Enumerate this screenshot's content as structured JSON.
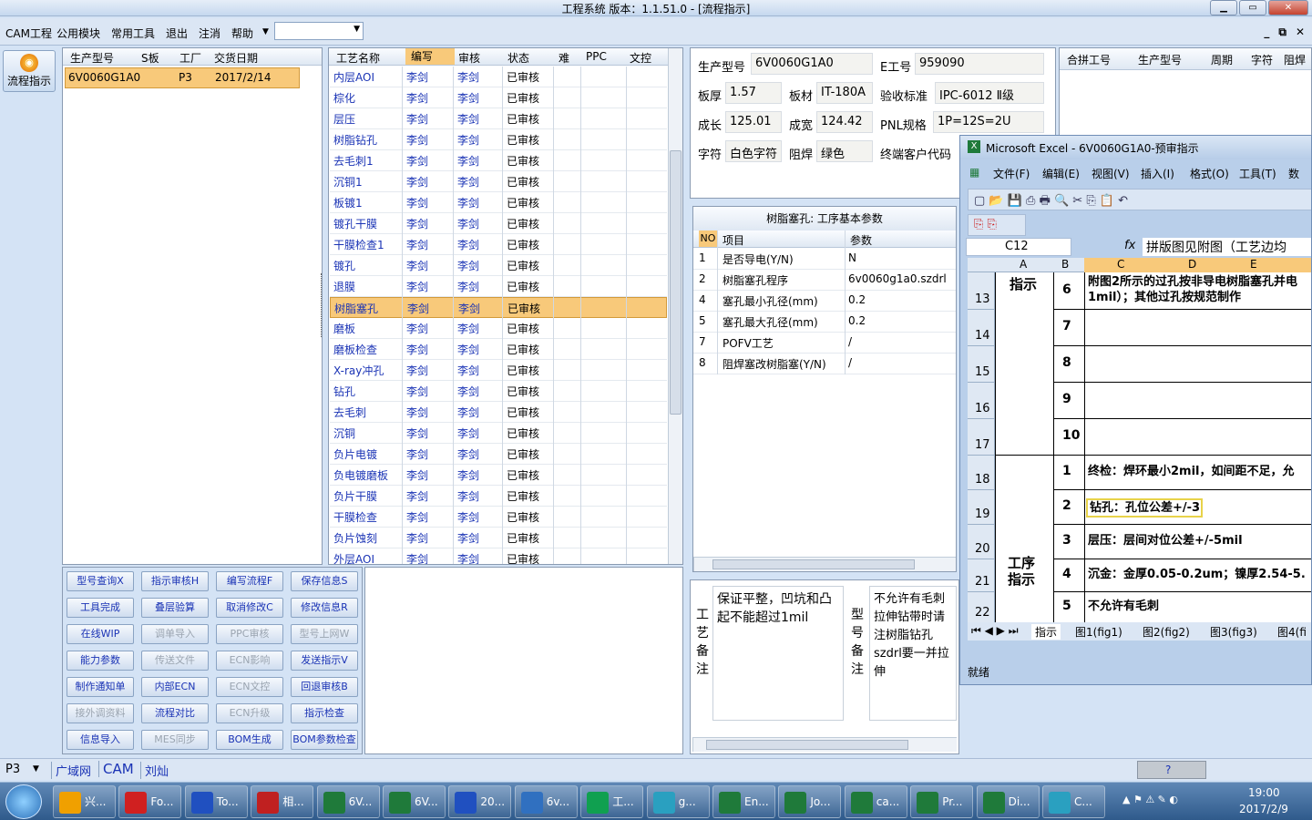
{
  "window": {
    "title": "工程系统   版本：1.1.51.0 - [流程指示]"
  },
  "menu": [
    "CAM工程",
    "公用模块",
    "常用工具",
    "退出",
    "注消",
    "帮助"
  ],
  "left": {
    "flow_button": "流程指示"
  },
  "orders": {
    "headers": [
      "生产型号",
      "S板",
      "工厂",
      "交货日期"
    ],
    "row": [
      "6V0060G1A0",
      "",
      "P3",
      "2017/2/14"
    ]
  },
  "process": {
    "headers": [
      "工艺名称",
      "编写",
      "审核",
      "状态",
      "难",
      "PPC",
      "文控"
    ],
    "rows": [
      [
        "内层AOI",
        "李剑",
        "李剑",
        "已审核"
      ],
      [
        "棕化",
        "李剑",
        "李剑",
        "已审核"
      ],
      [
        "层压",
        "李剑",
        "李剑",
        "已审核"
      ],
      [
        "树脂钻孔",
        "李剑",
        "李剑",
        "已审核"
      ],
      [
        "去毛刺1",
        "李剑",
        "李剑",
        "已审核"
      ],
      [
        "沉铜1",
        "李剑",
        "李剑",
        "已审核"
      ],
      [
        "板镀1",
        "李剑",
        "李剑",
        "已审核"
      ],
      [
        "镀孔干膜",
        "李剑",
        "李剑",
        "已审核"
      ],
      [
        "干膜检查1",
        "李剑",
        "李剑",
        "已审核"
      ],
      [
        "镀孔",
        "李剑",
        "李剑",
        "已审核"
      ],
      [
        "退膜",
        "李剑",
        "李剑",
        "已审核"
      ],
      [
        "树脂塞孔",
        "李剑",
        "李剑",
        "已审核"
      ],
      [
        "磨板",
        "李剑",
        "李剑",
        "已审核"
      ],
      [
        "磨板检查",
        "李剑",
        "李剑",
        "已审核"
      ],
      [
        "X-ray冲孔",
        "李剑",
        "李剑",
        "已审核"
      ],
      [
        "钻孔",
        "李剑",
        "李剑",
        "已审核"
      ],
      [
        "去毛刺",
        "李剑",
        "李剑",
        "已审核"
      ],
      [
        "沉铜",
        "李剑",
        "李剑",
        "已审核"
      ],
      [
        "负片电镀",
        "李剑",
        "李剑",
        "已审核"
      ],
      [
        "负电镀磨板",
        "李剑",
        "李剑",
        "已审核"
      ],
      [
        "负片干膜",
        "李剑",
        "李剑",
        "已审核"
      ],
      [
        "干膜检查",
        "李剑",
        "李剑",
        "已审核"
      ],
      [
        "负片蚀刻",
        "李剑",
        "李剑",
        "已审核"
      ],
      [
        "外层AOI",
        "李剑",
        "李剑",
        "已审核"
      ]
    ]
  },
  "buttons": [
    [
      "型号查询X",
      "指示审核H",
      "编写流程F",
      "保存信息S"
    ],
    [
      "工具完成",
      "叠层验算",
      "取消修改C",
      "修改信息R"
    ],
    [
      "在线WIP",
      "调单导入",
      "PPC审核",
      "型号上网W"
    ],
    [
      "能力参数",
      "传送文件",
      "ECN影响",
      "发送指示V"
    ],
    [
      "制作通知单",
      "内部ECN",
      "ECN文控",
      "回退审核B"
    ],
    [
      "接外调资料",
      "流程对比",
      "ECN升级",
      "指示检查"
    ],
    [
      "信息导入",
      "MES同步",
      "BOM生成",
      "BOM参数检查"
    ]
  ],
  "info": {
    "labels": [
      "生产型号",
      "E工号",
      "板厚",
      "板材",
      "验收标准",
      "成长",
      "成宽",
      "PNL规格",
      "字符",
      "阻焊",
      "终端客户代码"
    ],
    "values": [
      "6V0060G1A0",
      "959090",
      "1.57",
      "IT-180A",
      "IPC-6012 Ⅱ级",
      "125.01",
      "124.42",
      "1P=12S=2U",
      "白色字符",
      "绿色"
    ]
  },
  "params": {
    "title": "树脂塞孔: 工序基本参数",
    "headers": [
      "NO",
      "项目",
      "参数"
    ],
    "rows": [
      [
        "1",
        "是否导电(Y/N)",
        "N"
      ],
      [
        "2",
        "树脂塞孔程序",
        "6v0060g1a0.szdrl"
      ],
      [
        "4",
        "塞孔最小孔径(mm)",
        "0.2"
      ],
      [
        "5",
        "塞孔最大孔径(mm)",
        "0.2"
      ],
      [
        "7",
        "POFV工艺",
        "/"
      ],
      [
        "8",
        "阻焊塞改树脂塞(Y/N)",
        "/"
      ]
    ]
  },
  "notes": {
    "craft_label": "工艺备注",
    "craft_text": "保证平整，凹坑和凸起不能超过1mil",
    "model_label": "型号备注",
    "model_text": "不允许有毛刺拉伸钻带时请注树脂钻孔szdrl要一并拉伸"
  },
  "merge": {
    "headers": [
      "合拼工号",
      "生产型号",
      "周期",
      "字符",
      "阻焊"
    ]
  },
  "excel": {
    "title": "Microsoft Excel - 6V0060G1A0-预审指示",
    "menu": [
      "文件(F)",
      "编辑(E)",
      "视图(V)",
      "插入(I)",
      "格式(O)",
      "工具(T)",
      "数"
    ],
    "namebox": "C12",
    "formula": "拼版图见附图（工艺边均",
    "cols": [
      "A",
      "B",
      "C",
      "D",
      "E"
    ],
    "rows": [
      [
        "13",
        "6",
        "附图2所示的过孔按非导电树脂塞孔并电1mil）；其他过孔按规范制作"
      ],
      [
        "14",
        "7",
        ""
      ],
      [
        "15",
        "8",
        ""
      ],
      [
        "16",
        "9",
        ""
      ],
      [
        "17",
        "10",
        ""
      ],
      [
        "18",
        "1",
        "终检：焊环最小2mil，如间距不足，允"
      ],
      [
        "19",
        "2",
        "钻孔：孔位公差+/-3mil"
      ],
      [
        "20",
        "3",
        "层压：层间对位公差+/-5mil"
      ],
      [
        "21",
        "4",
        "沉金：金厚0.05-0.2um；镍厚2.54-5."
      ],
      [
        "22",
        "5",
        "不允许有毛刺"
      ]
    ],
    "a_label_1": "指示",
    "a_label_2": "工序指示",
    "sheets": [
      "指示",
      "图1(fig1)",
      "图2(fig2)",
      "图3(fig3)",
      "图4(fi"
    ],
    "status": "就绪"
  },
  "status": {
    "left": "P3",
    "tabs": [
      "广域网",
      "CAM",
      "刘灿"
    ]
  },
  "taskbar": {
    "items": [
      "兴...",
      "Fo...",
      "To...",
      "相...",
      "6V...",
      "6V...",
      "20...",
      "6v...",
      "工...",
      "g...",
      "En...",
      "Jo...",
      "ca...",
      "Pr...",
      "Di...",
      "C..."
    ],
    "time": "19:00",
    "date": "2017/2/9"
  }
}
